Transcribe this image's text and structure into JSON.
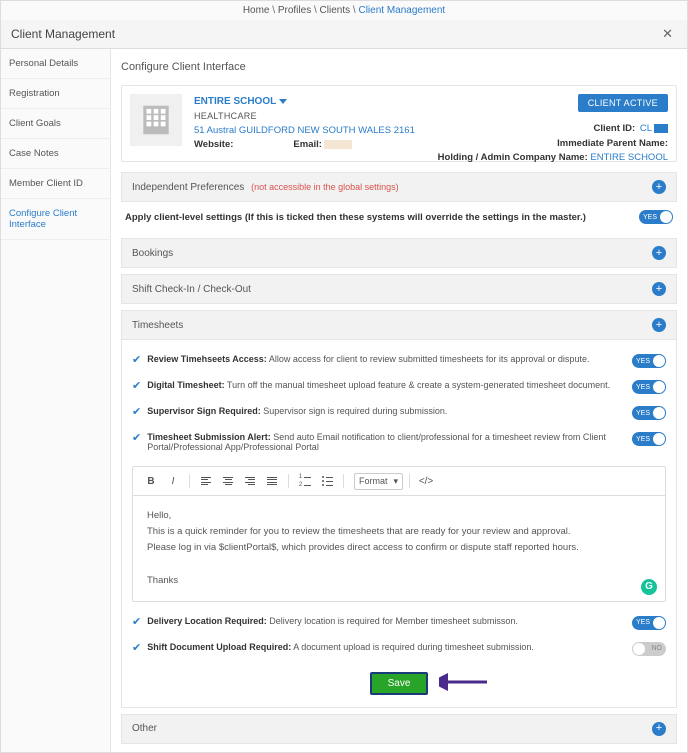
{
  "breadcrumb": {
    "home": "Home",
    "profiles": "Profiles",
    "clients": "Clients",
    "current": "Client Management"
  },
  "header": {
    "title": "Client Management"
  },
  "sidebar": {
    "items": [
      {
        "label": "Personal Details"
      },
      {
        "label": "Registration"
      },
      {
        "label": "Client Goals"
      },
      {
        "label": "Case Notes"
      },
      {
        "label": "Member Client ID"
      },
      {
        "label": "Configure Client Interface"
      }
    ]
  },
  "page": {
    "title": "Configure Client Interface"
  },
  "client": {
    "name": "ENTIRE SCHOOL",
    "type": "HEALTHCARE",
    "address": "51 Austral GUILDFORD NEW SOUTH WALES 2161",
    "website_lbl": "Website:",
    "email_lbl": "Email:",
    "active_badge": "CLIENT ACTIVE",
    "id_lbl": "Client ID:",
    "id_pre": "CL",
    "parent_lbl": "Immediate Parent Name:",
    "holding_lbl": "Holding / Admin Company Name:",
    "holding_val": "ENTIRE SCHOOL"
  },
  "sections": {
    "independent": {
      "title": "Independent Preferences",
      "note": "(not accessible in the global settings)"
    },
    "apply": {
      "label": "Apply client-level settings (If this is ticked then these systems will override the settings in the master.)",
      "toggle": "YES"
    },
    "bookings": "Bookings",
    "shift": "Shift Check-In / Check-Out",
    "timesheets": "Timesheets",
    "other": "Other"
  },
  "timesheets": {
    "opts": [
      {
        "title": "Review Timehseets Access:",
        "desc": "Allow access for client to review submitted timesheets for its approval or dispute.",
        "on": true
      },
      {
        "title": "Digital Timesheet:",
        "desc": "Turn off the manual timesheet upload feature & create a system-generated timesheet document.",
        "on": true
      },
      {
        "title": "Supervisor Sign Required:",
        "desc": "Supervisor sign is required during submission.",
        "on": true
      },
      {
        "title": "Timesheet Submission Alert:",
        "desc": "Send auto Email notification to client/professional for a timesheet review from Client Portal/Professional App/Professional Portal",
        "on": true
      },
      {
        "title": "Delivery Location Required:",
        "desc": "Delivery location is required for Member timesheet submisson.",
        "on": true
      },
      {
        "title": "Shift Document Upload Required:",
        "desc": "A document upload is required during timesheet submission.",
        "on": false
      }
    ]
  },
  "editor": {
    "format": "Format",
    "body": {
      "greeting": "Hello,",
      "line1": "This is a quick reminder for you to review the timesheets that are ready for your review and approval.",
      "line2": "Please log in via $clientPortal$, which provides direct access to confirm or dispute staff reported hours.",
      "signoff": "Thanks"
    }
  },
  "save_btn": "Save"
}
